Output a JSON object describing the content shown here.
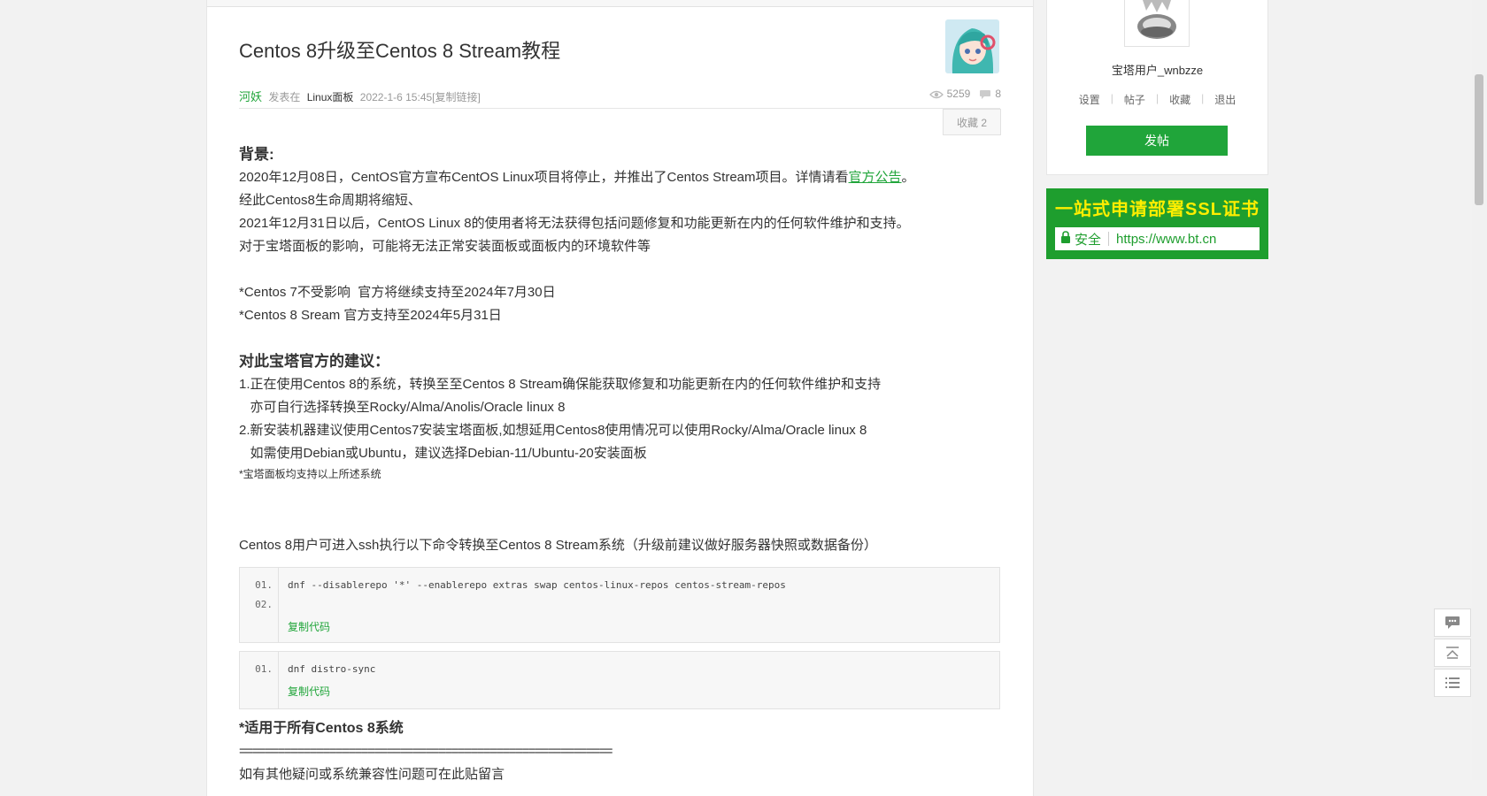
{
  "post": {
    "title": "Centos 8升级至Centos 8 Stream教程",
    "author": "河妖",
    "posted_in": "发表在",
    "forum": "Linux面板",
    "date": "2022-1-6 15:45",
    "copy_link": "[复制链接]",
    "views": "5259",
    "replies": "8",
    "favorite_button": "收藏 2"
  },
  "content": {
    "background_heading": "背景:",
    "bg_line1_prefix": "2020年12月08日，CentOS官方宣布CentOS Linux项目将停止，并推出了Centos Stream项目。详情请看",
    "bg_line1_link": "官方公告",
    "bg_line1_suffix": "。",
    "bg_line2": "经此Centos8生命周期将缩短、",
    "bg_line3": "2021年12月31日以后，CentOS Linux 8的使用者将无法获得包括问题修复和功能更新在内的任何软件维护和支持。",
    "bg_line4": "对于宝塔面板的影响，可能将无法正常安装面板或面板内的环境软件等",
    "note1": "*Centos 7不受影响  官方将继续支持至2024年7月30日",
    "note2": "*Centos 8 Sream 官方支持至2024年5月31日",
    "advice_heading": "对此宝塔官方的建议：",
    "advice1": "1.正在使用Centos 8的系统，转换至至Centos 8 Stream确保能获取修复和功能更新在内的任何软件维护和支持",
    "advice1b": "   亦可自行选择转换至Rocky/Alma/Anolis/Oracle linux 8",
    "advice2": "2.新安装机器建议使用Centos7安装宝塔面板,如想延用Centos8使用情况可以使用Rocky/Alma/Oracle linux 8",
    "advice2b": "   如需使用Debian或Ubuntu，建议选择Debian-11/Ubuntu-20安装面板",
    "support_note": "*宝塔面板均支持以上所述系统",
    "convert_intro": "Centos 8用户可进入ssh执行以下命令转换至Centos 8 Stream系统（升级前建议做好服务器快照或数据备份）",
    "applies_note": "*适用于所有Centos 8系统",
    "separator": "==========================================================",
    "question_line": "如有其他疑问或系统兼容性问题可在此贴留言"
  },
  "code_blocks": [
    {
      "line_numbers": [
        "01.",
        "02."
      ],
      "lines": [
        "dnf --disablerepo '*' --enablerepo extras swap centos-linux-repos centos-stream-repos",
        ""
      ],
      "copy_label": "复制代码"
    },
    {
      "line_numbers": [
        "01."
      ],
      "lines": [
        "dnf distro-sync"
      ],
      "copy_label": "复制代码"
    }
  ],
  "sidebar": {
    "username": "宝塔用户_wnbzze",
    "links": [
      "设置",
      "帖子",
      "收藏",
      "退出"
    ],
    "post_button": "发帖"
  },
  "ssl_ad": {
    "title": "一站式申请部署SSL证书",
    "secure_label": "安全",
    "url": "https://www.bt.cn"
  },
  "colors": {
    "brand_green": "#20a53a",
    "ssl_green": "#1e9e2e",
    "ssl_yellow": "#ffee00"
  },
  "icons": {
    "views": "eye-icon",
    "replies": "comment-icon",
    "float_tools": [
      "comment-icon",
      "back-to-top-icon",
      "list-icon"
    ]
  }
}
